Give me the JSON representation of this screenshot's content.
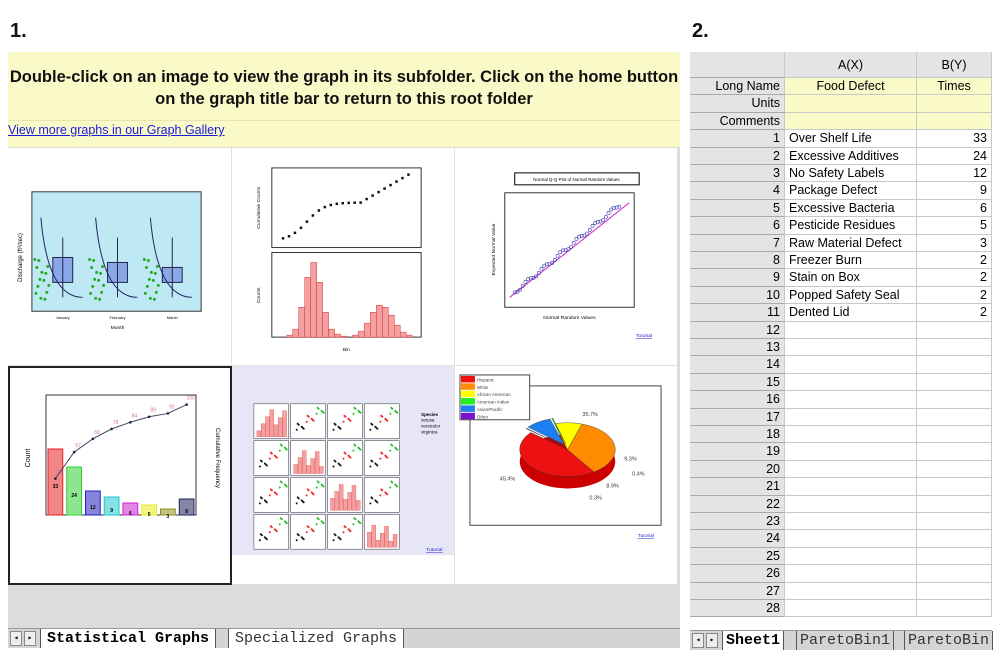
{
  "labels": {
    "left": "1.",
    "right": "2."
  },
  "header": {
    "message": "Double-click on an image to view the graph in its subfolder. Click on the home button on the graph title bar to return to this root folder",
    "gallery_link": "View more graphs in our Graph Gallery"
  },
  "thumbnails": [
    {
      "id": "box-chart",
      "ylabel": "Discharge (ft³/sec)",
      "xlabel": "Month",
      "categories": [
        "January",
        "February",
        "March"
      ]
    },
    {
      "id": "histogram-cumulative",
      "ylabel_top": "Cumulative Counts",
      "ylabel_bottom": "Counts",
      "xlabel": "Bin"
    },
    {
      "id": "qq-plot",
      "title": "Normal Q-Q Plot of Normal Random Values",
      "xlabel": "Normal Random Values",
      "ylabel": "Expected Normal Value",
      "link": "Tutorial"
    },
    {
      "id": "pareto-chart",
      "ylabel": "Count",
      "y2label": "Cumulative Frequency",
      "values": [
        33,
        24,
        12,
        9,
        6,
        5,
        3,
        8
      ],
      "cumulative": [
        33,
        57,
        69,
        78,
        84,
        89,
        92,
        100
      ],
      "colors": [
        "#e82020",
        "#30d030",
        "#2020c0",
        "#20c8d0",
        "#d020d0",
        "#e8e820",
        "#909020",
        "#202060"
      ]
    },
    {
      "id": "scatter-matrix",
      "legend": [
        "Species",
        "setosa",
        "versicolor",
        "virginica"
      ],
      "link": "Tutorial"
    },
    {
      "id": "pie-3d",
      "legend": [
        "Hispanic",
        "White",
        "African American",
        "American Indian",
        "Asian/Pacific",
        "Other"
      ],
      "values": [
        45.4,
        35.7,
        9.3,
        0.4,
        8.9,
        0.3
      ],
      "value_labels": [
        "45.4%",
        "35.7%",
        "9.3%",
        "0.4%",
        "8.9%",
        "0.3%"
      ],
      "colors": [
        "#ee1111",
        "#ff8c00",
        "#ffff00",
        "#22ee22",
        "#1e7ff0",
        "#7a10d0"
      ],
      "link": "Tutorial"
    }
  ],
  "left_tabs": [
    "Statistical Graphs",
    "Specialized Graphs"
  ],
  "sheet": {
    "columns": [
      "A(X)",
      "B(Y)"
    ],
    "meta_rows": [
      {
        "label": "Long Name",
        "a": "Food Defect",
        "b": "Times"
      },
      {
        "label": "Units",
        "a": "",
        "b": ""
      },
      {
        "label": "Comments",
        "a": "",
        "b": ""
      }
    ],
    "rows": [
      {
        "n": "1",
        "a": "Over Shelf Life",
        "b": "33"
      },
      {
        "n": "2",
        "a": "Excessive Additives",
        "b": "24"
      },
      {
        "n": "3",
        "a": "No Safety Labels",
        "b": "12"
      },
      {
        "n": "4",
        "a": "Package Defect",
        "b": "9"
      },
      {
        "n": "5",
        "a": "Excessive Bacteria",
        "b": "6"
      },
      {
        "n": "6",
        "a": "Pesticide Residues",
        "b": "5"
      },
      {
        "n": "7",
        "a": "Raw Material Defect",
        "b": "3"
      },
      {
        "n": "8",
        "a": "Freezer Burn",
        "b": "2"
      },
      {
        "n": "9",
        "a": "Stain on Box",
        "b": "2"
      },
      {
        "n": "10",
        "a": "Popped Safety Seal",
        "b": "2"
      },
      {
        "n": "11",
        "a": "Dented Lid",
        "b": "2"
      },
      {
        "n": "12",
        "a": "",
        "b": ""
      },
      {
        "n": "13",
        "a": "",
        "b": ""
      },
      {
        "n": "14",
        "a": "",
        "b": ""
      },
      {
        "n": "15",
        "a": "",
        "b": ""
      },
      {
        "n": "16",
        "a": "",
        "b": ""
      },
      {
        "n": "17",
        "a": "",
        "b": ""
      },
      {
        "n": "18",
        "a": "",
        "b": ""
      },
      {
        "n": "19",
        "a": "",
        "b": ""
      },
      {
        "n": "20",
        "a": "",
        "b": ""
      },
      {
        "n": "21",
        "a": "",
        "b": ""
      },
      {
        "n": "22",
        "a": "",
        "b": ""
      },
      {
        "n": "23",
        "a": "",
        "b": ""
      },
      {
        "n": "24",
        "a": "",
        "b": ""
      },
      {
        "n": "25",
        "a": "",
        "b": ""
      },
      {
        "n": "26",
        "a": "",
        "b": ""
      },
      {
        "n": "27",
        "a": "",
        "b": ""
      },
      {
        "n": "28",
        "a": "",
        "b": ""
      }
    ],
    "tabs": [
      "Sheet1",
      "ParetoBin1",
      "ParetoBin"
    ]
  }
}
